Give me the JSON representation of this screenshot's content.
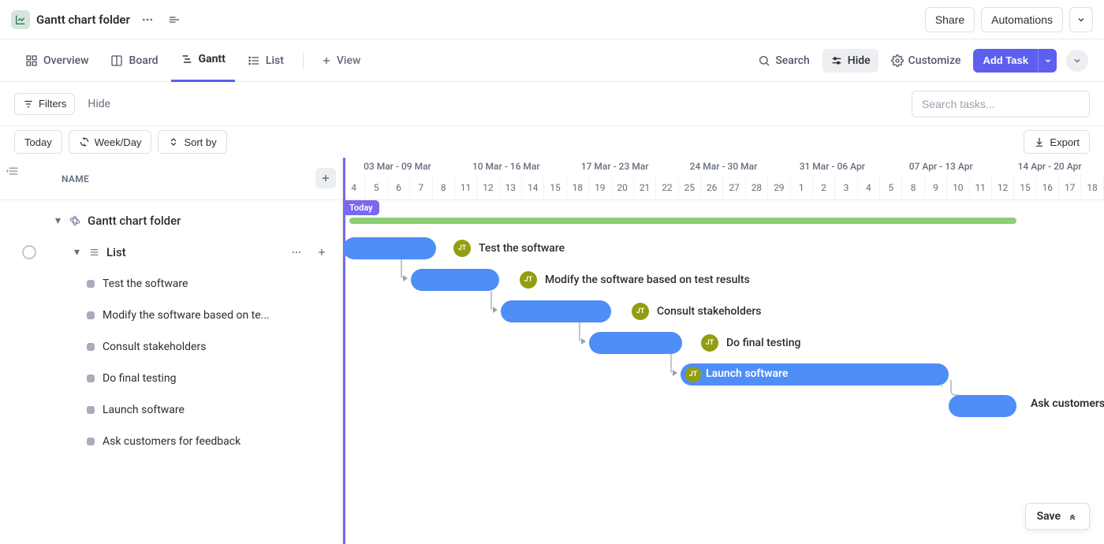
{
  "top": {
    "folder_title": "Gantt chart folder",
    "share": "Share",
    "automations": "Automations"
  },
  "tabs": {
    "overview": "Overview",
    "board": "Board",
    "gantt": "Gantt",
    "list": "List",
    "add_view": "View",
    "search": "Search",
    "hide": "Hide",
    "customize": "Customize",
    "add_task": "Add Task"
  },
  "filters": {
    "filters": "Filters",
    "hide": "Hide",
    "search_placeholder": "Search tasks..."
  },
  "toolbar": {
    "today": "Today",
    "scale": "Week/Day",
    "sort": "Sort by",
    "export": "Export"
  },
  "sidebar": {
    "name_header": "NAME",
    "folder": "Gantt chart folder",
    "list": "List",
    "tasks": [
      "Test the software",
      "Modify the software based on te...",
      "Consult stakeholders",
      "Do final testing",
      "Launch software",
      "Ask customers for feedback"
    ]
  },
  "timeline": {
    "today": "Today",
    "weeks": [
      "03 Mar - 09 Mar",
      "10 Mar - 16 Mar",
      "17 Mar - 23 Mar",
      "24 Mar - 30 Mar",
      "31 Mar - 06 Apr",
      "07 Apr - 13 Apr",
      "14 Apr - 20 Apr"
    ],
    "days": [
      "4",
      "5",
      "6",
      "7",
      "8",
      "11",
      "12",
      "13",
      "14",
      "15",
      "18",
      "19",
      "20",
      "21",
      "22",
      "25",
      "26",
      "27",
      "28",
      "29",
      "1",
      "2",
      "3",
      "4",
      "5",
      "8",
      "9",
      "10",
      "11",
      "12",
      "15",
      "16",
      "17",
      "18"
    ]
  },
  "gantt": {
    "avatar_initials": "JT",
    "tasks": [
      {
        "label": "Test the software"
      },
      {
        "label": "Modify the software based on test results"
      },
      {
        "label": "Consult stakeholders"
      },
      {
        "label": "Do final testing"
      },
      {
        "label": "Launch software"
      },
      {
        "label": "Ask customers"
      }
    ]
  },
  "save": "Save",
  "chart_data": {
    "type": "gantt",
    "date_range": {
      "start": "2024-03-04",
      "end": "2024-04-18"
    },
    "today": "2024-03-04",
    "summary": {
      "name": "List",
      "start": "2024-03-04",
      "end": "2024-04-12"
    },
    "tasks": [
      {
        "name": "Test the software",
        "start": "2024-03-04",
        "end": "2024-03-08",
        "assignee": "JT"
      },
      {
        "name": "Modify the software based on test results",
        "start": "2024-03-09",
        "end": "2024-03-13",
        "assignee": "JT",
        "depends_on": "Test the software"
      },
      {
        "name": "Consult stakeholders",
        "start": "2024-03-13",
        "end": "2024-03-20",
        "assignee": "JT",
        "depends_on": "Modify the software based on test results"
      },
      {
        "name": "Do final testing",
        "start": "2024-03-20",
        "end": "2024-03-25",
        "assignee": "JT",
        "depends_on": "Consult stakeholders"
      },
      {
        "name": "Launch software",
        "start": "2024-03-25",
        "end": "2024-04-09",
        "assignee": "JT",
        "depends_on": "Do final testing"
      },
      {
        "name": "Ask customers for feedback",
        "start": "2024-04-09",
        "end": "2024-04-12",
        "assignee": "JT",
        "depends_on": "Launch software"
      }
    ]
  }
}
